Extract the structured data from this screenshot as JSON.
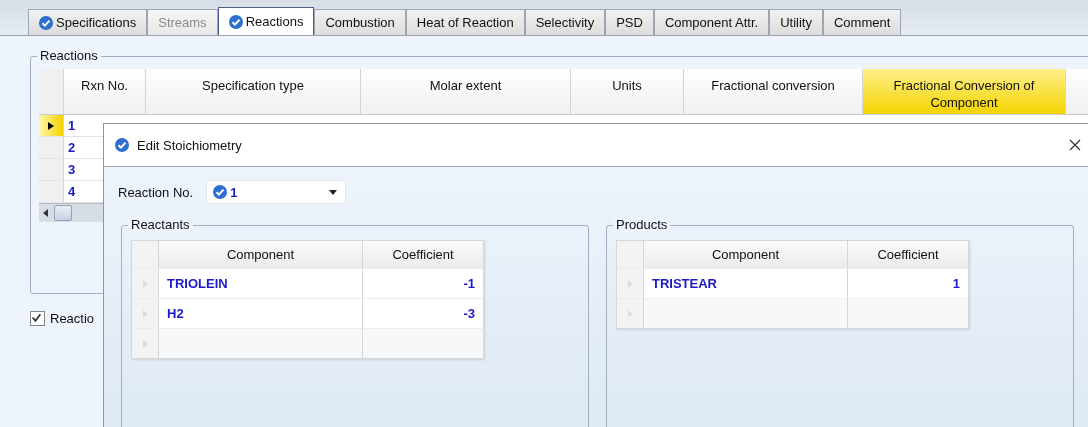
{
  "tabs": [
    {
      "label": "Specifications",
      "checked": true,
      "disabled": false,
      "selected": false
    },
    {
      "label": "Streams",
      "checked": false,
      "disabled": true,
      "selected": false
    },
    {
      "label": "Reactions",
      "checked": true,
      "disabled": false,
      "selected": true
    },
    {
      "label": "Combustion",
      "checked": false,
      "disabled": false,
      "selected": false
    },
    {
      "label": "Heat of Reaction",
      "checked": false,
      "disabled": false,
      "selected": false
    },
    {
      "label": "Selectivity",
      "checked": false,
      "disabled": false,
      "selected": false
    },
    {
      "label": "PSD",
      "checked": false,
      "disabled": false,
      "selected": false
    },
    {
      "label": "Component Attr.",
      "checked": false,
      "disabled": false,
      "selected": false
    },
    {
      "label": "Utility",
      "checked": false,
      "disabled": false,
      "selected": false
    },
    {
      "label": "Comment",
      "checked": false,
      "disabled": false,
      "selected": false
    }
  ],
  "reactions": {
    "legend": "Reactions",
    "columns": [
      {
        "label": "Rxn No.",
        "selected": false
      },
      {
        "label": "Specification type",
        "selected": false
      },
      {
        "label": "Molar extent",
        "selected": false
      },
      {
        "label": "Units",
        "selected": false
      },
      {
        "label": "Fractional conversion",
        "selected": false
      },
      {
        "label": "Fractional Conversion of Component",
        "selected": true
      }
    ],
    "rows": [
      {
        "rxn_no": "1",
        "selected": true
      },
      {
        "rxn_no": "2",
        "selected": false
      },
      {
        "rxn_no": "3",
        "selected": false
      },
      {
        "rxn_no": "4",
        "selected": false
      }
    ]
  },
  "checkbox": {
    "label": "Reactio",
    "checked": true
  },
  "dialog": {
    "title": "Edit Stoichiometry",
    "reaction_no": {
      "label": "Reaction No.",
      "value": "1",
      "checked": true
    },
    "reactants": {
      "legend": "Reactants",
      "columns": [
        "Component",
        "Coefficient"
      ],
      "rows": [
        {
          "component": "TRIOLEIN",
          "coefficient": "-1"
        },
        {
          "component": "H2",
          "coefficient": "-3"
        }
      ]
    },
    "products": {
      "legend": "Products",
      "columns": [
        "Component",
        "Coefficient"
      ],
      "rows": [
        {
          "component": "TRISTEAR",
          "coefficient": "1"
        }
      ]
    }
  }
}
